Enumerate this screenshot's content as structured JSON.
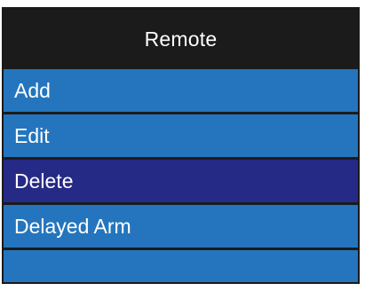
{
  "title": "Remote",
  "menu": {
    "items": [
      {
        "label": "Add",
        "selected": false
      },
      {
        "label": "Edit",
        "selected": false
      },
      {
        "label": "Delete",
        "selected": true
      },
      {
        "label": "Delayed Arm",
        "selected": false
      },
      {
        "label": "",
        "selected": false
      }
    ]
  },
  "colors": {
    "title_bg": "#1b1b1b",
    "item_bg": "#2475bd",
    "selected_bg": "#252a86",
    "text": "#ffffff"
  }
}
